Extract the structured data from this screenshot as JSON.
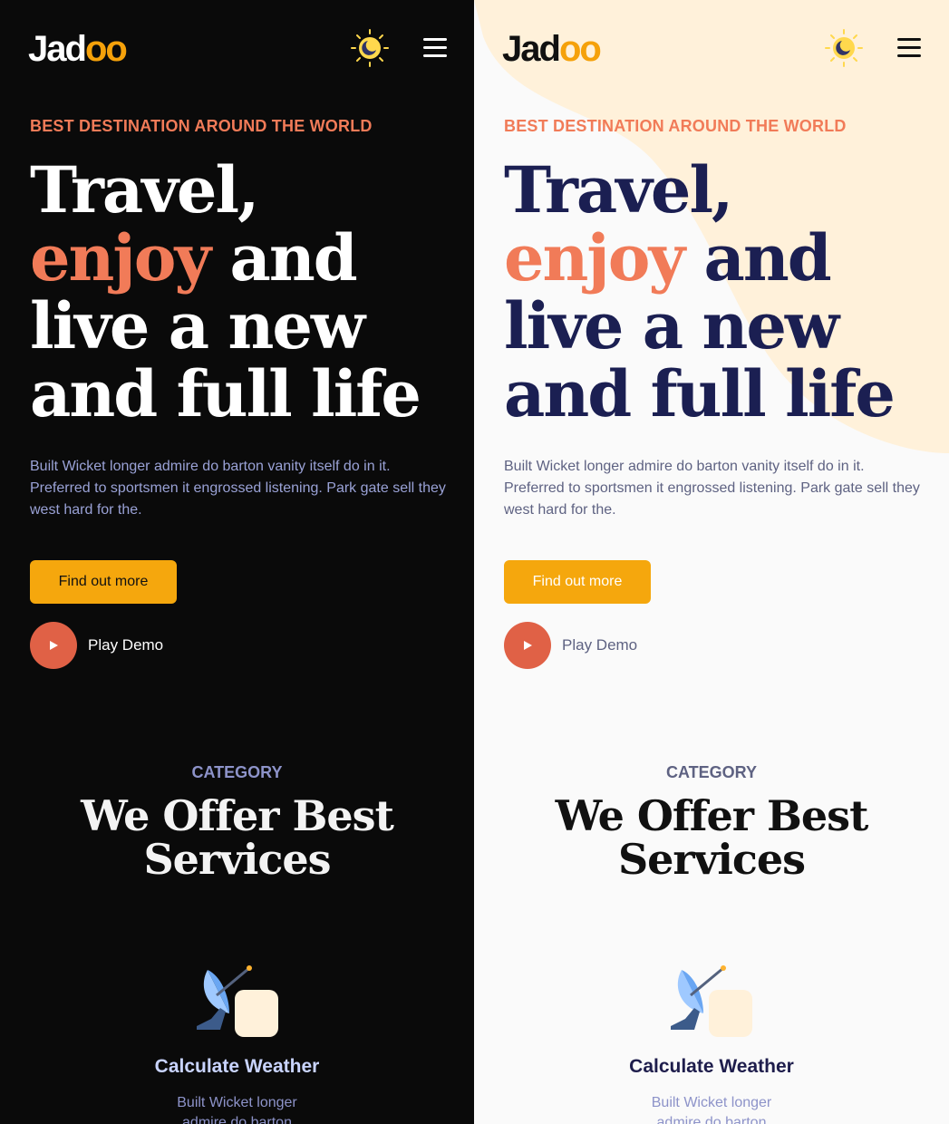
{
  "brand": {
    "logo_prefix": "Jad",
    "logo_suffix": "oo",
    "accent_color": "#f5a10a",
    "highlight_color": "#f17b58"
  },
  "header": {
    "theme_toggle_icon": "sun-moon-icon",
    "menu_icon": "hamburger-menu-icon"
  },
  "hero": {
    "eyebrow": "BEST DESTINATION AROUND THE WORLD",
    "line1": "Travel,",
    "line2_accent": "enjoy",
    "line2_rest": " and",
    "line3": "live a new",
    "line4": "and full life",
    "description": "Built Wicket longer admire do barton vanity itself do in it. Preferred to sportsmen it engrossed listening. Park gate sell they west hard for the.",
    "cta_label": "Find out more",
    "play_label": "Play Demo"
  },
  "category": {
    "eyebrow": "CATEGORY",
    "title_line1": "We Offer Best",
    "title_line2": "Services"
  },
  "service": {
    "icon": "satellite-dish-icon",
    "title": "Calculate Weather",
    "desc_line1": "Built Wicket longer",
    "desc_line2": "admire do barton"
  },
  "themes": {
    "dark_bg": "#0a0a0a",
    "light_bg": "#fafafa",
    "light_blob": "#fff1da"
  }
}
